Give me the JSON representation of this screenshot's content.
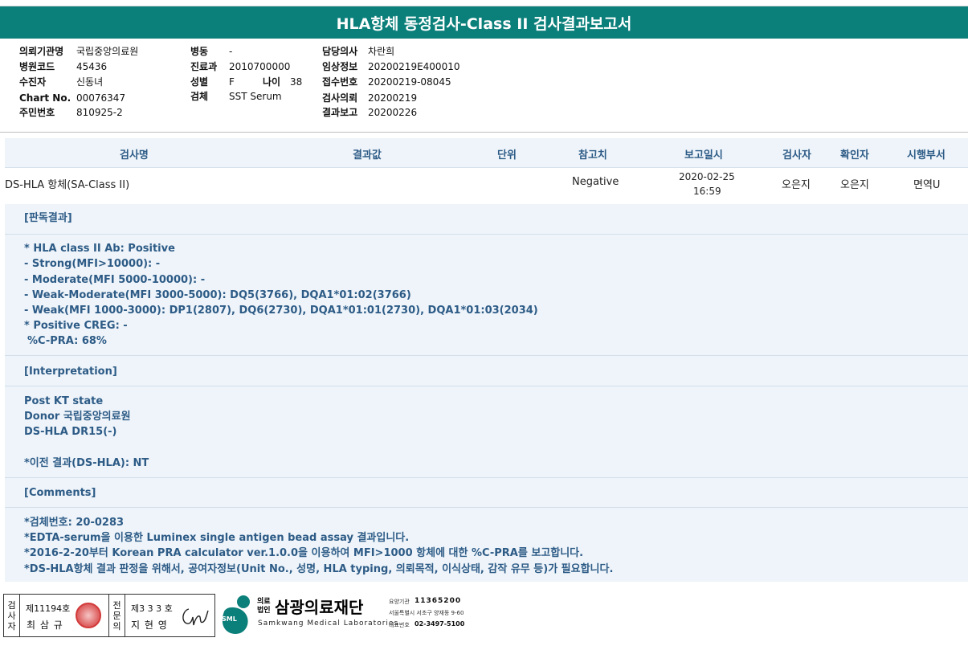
{
  "report_title": "HLA항체 동정검사-Class II 검사결과보고서",
  "patient_info": {
    "col1": [
      {
        "label": "의뢰기관명",
        "value": "국립중앙의료원"
      },
      {
        "label": "병원코드",
        "value": "45436"
      },
      {
        "label": "수진자",
        "value": "신동녀"
      },
      {
        "label": "Chart No.",
        "value": "00076347"
      },
      {
        "label": "주민번호",
        "value": "810925-2"
      }
    ],
    "col2": [
      {
        "label": "병동",
        "value": "-"
      },
      {
        "label": "진료과",
        "value": "2010700000"
      },
      {
        "label": "성별",
        "value": "F"
      },
      {
        "label": "검체",
        "value": "SST Serum"
      }
    ],
    "age_label": "나이",
    "age_value": "38",
    "col3": [
      {
        "label": "담당의사",
        "value": "차란희"
      },
      {
        "label": "임상정보",
        "value": "20200219E400010"
      },
      {
        "label": "접수번호",
        "value": "20200219-08045"
      },
      {
        "label": "검사의뢰",
        "value": "20200219"
      },
      {
        "label": "결과보고",
        "value": "20200226"
      }
    ]
  },
  "table": {
    "headers": [
      "검사명",
      "결과값",
      "단위",
      "참고치",
      "보고일시",
      "검사자",
      "확인자",
      "시행부서"
    ],
    "row": {
      "test_name": "DS-HLA 항체(SA-Class II)",
      "result": "",
      "unit": "",
      "reference": "Negative",
      "report_date": "2020-02-25",
      "report_time": "16:59",
      "tester": "오은지",
      "confirmer": "오은지",
      "department": "면역U"
    }
  },
  "sections": {
    "judgement_title": "[판독결과]",
    "judgement_lines": [
      "* HLA class II Ab: Positive",
      "- Strong(MFI>10000): -",
      "- Moderate(MFI 5000-10000): -",
      "- Weak-Moderate(MFI 3000-5000): DQ5(3766), DQA1*01:02(3766)",
      "- Weak(MFI 1000-3000): DP1(2807), DQ6(2730), DQA1*01:01(2730), DQA1*01:03(2034)",
      "* Positive CREG: -",
      " %C-PRA: 68%"
    ],
    "interpretation_title": "[Interpretation]",
    "interpretation_lines": [
      "Post KT state",
      "Donor 국립중앙의료원",
      "DS-HLA DR15(-)",
      "*이전 결과(DS-HLA): NT"
    ],
    "comments_title": "[Comments]",
    "comments_lines": [
      "*검체번호: 20-0283",
      "*EDTA-serum을 이용한 Luminex single antigen bead assay 결과입니다.",
      "*2016-2-20부터 Korean PRA calculator ver.1.0.0을 이용하여 MFI>1000 항체에 대한 %C-PRA를 보고합니다.",
      "*DS-HLA항체 결과 판정을 위해서, 공여자정보(Unit No., 성명, HLA typing, 의뢰목적, 이식상태, 감작 유무 등)가 필요합니다."
    ]
  },
  "footer": {
    "tester_label": "검사자",
    "tester_license": "제11194호",
    "tester_name": "최 삼 규",
    "specialist_label": "전문의",
    "specialist_license": "제3 3 3 호",
    "specialist_name": "지 현 영",
    "org_prefix_1": "의료",
    "org_prefix_2": "법인",
    "org_name": "삼광의료재단",
    "org_name_en": "Samkwang Medical Laboratories",
    "logo_badge": "SML",
    "care_code_label": "요양기관",
    "care_code": "11365200",
    "address": "서울특별시 서초구 양재동 9-60",
    "phone_label": "대표번호",
    "phone": "02-3497-5100",
    "brand_color": "#0b7f7a"
  }
}
